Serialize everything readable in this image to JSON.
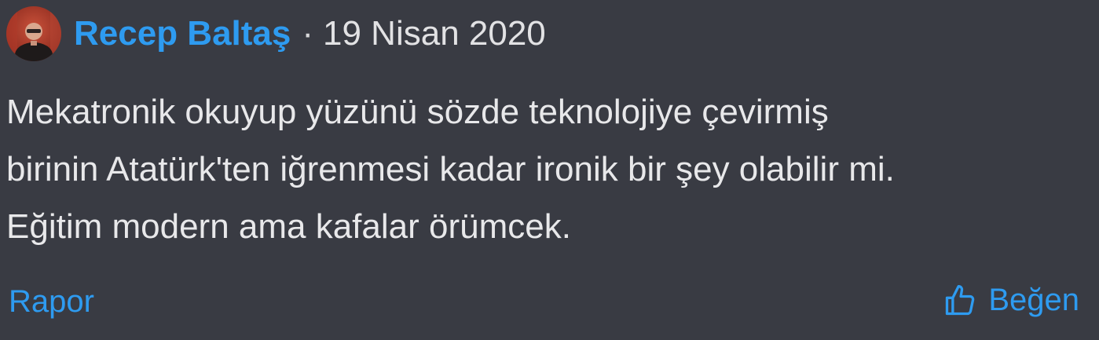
{
  "comment": {
    "author": "Recep Baltaş",
    "separator": "·",
    "date": "19 Nisan 2020",
    "text": "Mekatronik okuyup yüzünü sözde teknolojiye çevirmiş\nbirinin Atatürk'ten iğrenmesi kadar ironik bir şey olabilir mi.\nEğitim modern ama kafalar örümcek.",
    "report_label": "Rapor",
    "like_label": "Beğen",
    "like_icon": "thumbs-up-outline-icon"
  },
  "colors": {
    "background": "#393b43",
    "accent": "#2e9bf0",
    "text": "#e8e8ea"
  }
}
